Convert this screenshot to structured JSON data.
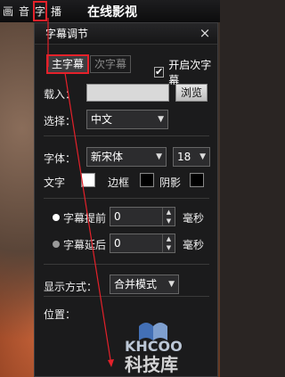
{
  "topbar": {
    "buttons": [
      "画",
      "音",
      "字",
      "播"
    ],
    "title": "在线影视"
  },
  "panel": {
    "title": "字幕调节",
    "close": "×",
    "tabs": [
      "主字幕",
      "次字幕"
    ],
    "enable_secondary_label": "开启次字幕",
    "enable_secondary_checked": "✔",
    "load_label": "载入：",
    "browse_label": "浏览",
    "select_label": "选择：",
    "language_value": "中文",
    "font_label": "字体：",
    "font_value": "新宋体",
    "size_value": "18",
    "text_color_label": "文字",
    "border_label": "边框",
    "shadow_label": "阴影",
    "advance_label": "字幕提前",
    "advance_value": "0",
    "advance_unit": "毫秒",
    "delay_label": "字幕延后",
    "delay_value": "0",
    "delay_unit": "毫秒",
    "display_mode_label": "显示方式：",
    "display_mode_value": "合并模式",
    "position_label": "位置："
  },
  "watermark": {
    "logo_text": "KHCOO",
    "site_text": "科技库"
  },
  "colors": {
    "accent_red": "#e4212a",
    "panel_bg": "#1b1b1c",
    "text_swatch": "#ffffff",
    "border_swatch": "#000000",
    "shadow_swatch": "#000000"
  }
}
